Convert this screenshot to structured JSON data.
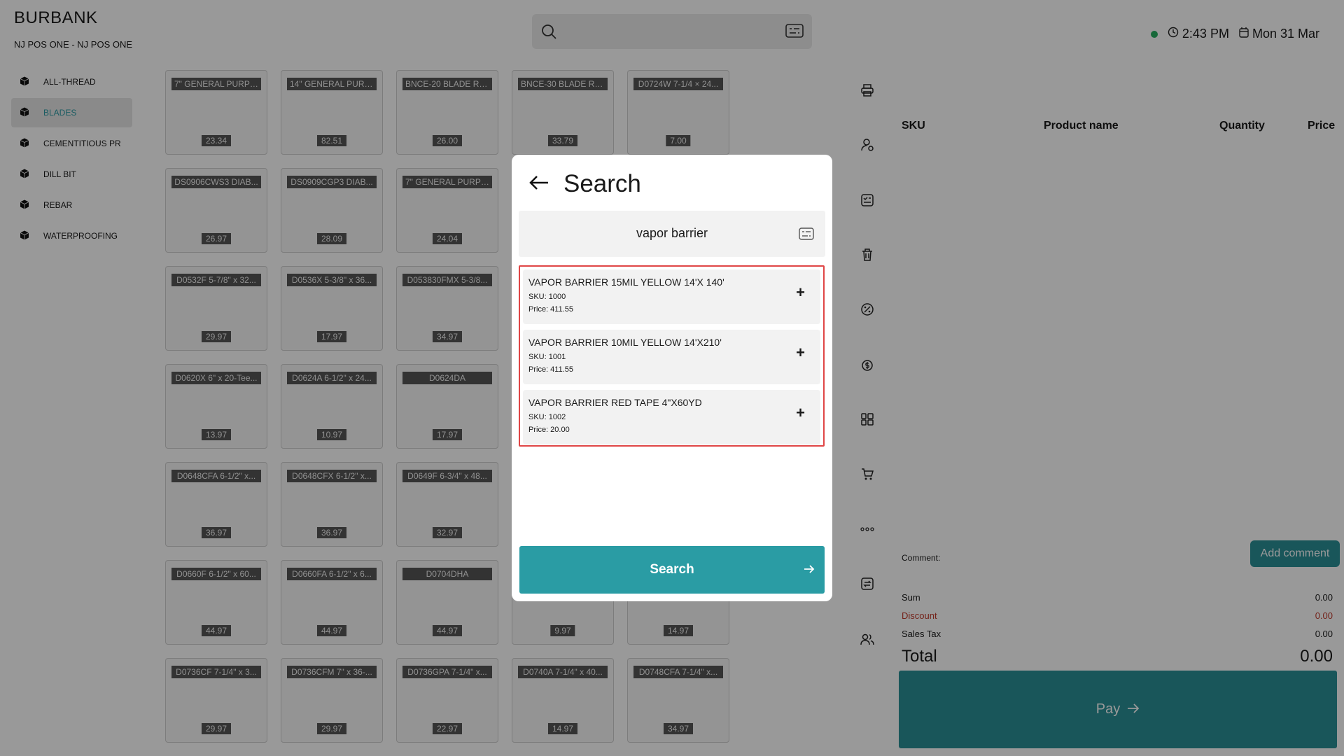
{
  "header": {
    "store_name": "BURBANK",
    "register": "NJ POS ONE - NJ POS ONE",
    "time": "2:43 PM",
    "date": "Mon 31 Mar",
    "status_color": "#27ae60"
  },
  "categories": [
    {
      "label": "ALL-THREAD"
    },
    {
      "label": "BLADES",
      "active": true
    },
    {
      "label": "CEMENTITIOUS PR"
    },
    {
      "label": "DILL BIT"
    },
    {
      "label": "REBAR"
    },
    {
      "label": "WATERPROOFING"
    }
  ],
  "products": [
    {
      "name": "7\" GENERAL PURPO...",
      "price": "23.34"
    },
    {
      "name": "14\" GENERAL PURP...",
      "price": "82.51"
    },
    {
      "name": "BNCE-20 BLADE RE...",
      "price": "26.00"
    },
    {
      "name": "BNCE-30 BLADE RE...",
      "price": "33.79"
    },
    {
      "name": "D0724W 7-1/4 × 24...",
      "price": "7.00"
    },
    {
      "name": "DS0906CWS3 DIAB...",
      "price": "26.97"
    },
    {
      "name": "DS0909CGP3 DIAB...",
      "price": "28.09"
    },
    {
      "name": "7\" GENERAL PURPO...",
      "price": "24.04"
    },
    {
      "name": "D0532F 5-7/8\" x 32...",
      "price": "29.97"
    },
    {
      "name": "D0536X 5-3/8\" x 36...",
      "price": "17.97"
    },
    {
      "name": "D053830FMX 5-3/8...",
      "price": "34.97"
    },
    {
      "name": "D0620X 6\" x 20-Tee...",
      "price": "13.97"
    },
    {
      "name": "D0624A 6-1/2\" x 24...",
      "price": "10.97"
    },
    {
      "name": "D0624DA",
      "price": "17.97"
    },
    {
      "name": "D0648CFA 6-1/2\" x...",
      "price": "36.97"
    },
    {
      "name": "D0648CFX 6-1/2\" x...",
      "price": "36.97"
    },
    {
      "name": "D0649F 6-3/4\" x 48...",
      "price": "32.97"
    },
    {
      "name": "D0660F 6-1/2\" x 60...",
      "price": "44.97"
    },
    {
      "name": "D0660FA 6-1/2\" x 6...",
      "price": "44.97"
    },
    {
      "name": "D0704DHA",
      "price": "44.97"
    },
    {
      "name": "",
      "price": "9.97"
    },
    {
      "name": "",
      "price": "14.97"
    },
    {
      "name": "D0736CF 7-1/4\" x 3...",
      "price": "29.97"
    },
    {
      "name": "D0736CFM 7\" x 36-...",
      "price": "29.97"
    },
    {
      "name": "D0736GPA 7-1/4\" x...",
      "price": "22.97"
    },
    {
      "name": "D0740A 7-1/4\" x 40...",
      "price": "14.97"
    },
    {
      "name": "D0748CFA 7-1/4\" x...",
      "price": "34.97"
    }
  ],
  "cart": {
    "headers": {
      "sku": "SKU",
      "name": "Product name",
      "qty": "Quantity",
      "price": "Price"
    },
    "comment_label": "Comment:",
    "add_comment": "Add comment",
    "sum_label": "Sum",
    "sum": "0.00",
    "discount_label": "Discount",
    "discount": "0.00",
    "discount_color": "#c0392b",
    "tax_label": "Sales Tax",
    "tax": "0.00",
    "total_label": "Total",
    "total": "0.00",
    "pay_label": "Pay"
  },
  "modal": {
    "title": "Search",
    "query": "vapor barrier",
    "results": [
      {
        "name": "VAPOR BARRIER 15MIL YELLOW 14'X 140'",
        "sku": "SKU: 1000",
        "price": "Price: 411.55"
      },
      {
        "name": "VAPOR BARRIER 10MIL YELLOW 14'X210'",
        "sku": "SKU: 1001",
        "price": "Price: 411.55"
      },
      {
        "name": "VAPOR BARRIER RED TAPE 4\"X60YD",
        "sku": "SKU: 1002",
        "price": "Price: 20.00"
      }
    ],
    "add_symbol": "+",
    "search_button": "Search",
    "accent_color": "#2a9ca4",
    "highlight_color": "#e04646"
  },
  "icons": [
    "search-icon",
    "keyboard-icon",
    "clock-icon",
    "calendar-icon",
    "cube-icon",
    "printer-icon",
    "customer-icon",
    "receipt-icon",
    "trash-icon",
    "percent-icon",
    "coin-icon",
    "grid-icon",
    "cart-icon",
    "more-icon",
    "exchange-icon",
    "users-icon",
    "back-arrow-icon",
    "arrow-right-icon"
  ]
}
